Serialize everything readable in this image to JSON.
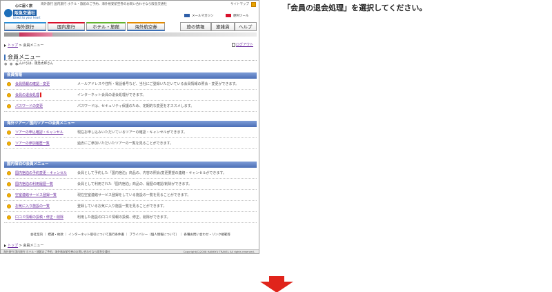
{
  "header": {
    "tagline": "海外旅行 国内旅行 ホテル・旅館のご予約、海外格安航空券のお問い合わせなら阪急交通社",
    "sitemap_label": "サイトマップ",
    "logo_top": "心に届く旅",
    "logo_name": "阪急交通社",
    "logo_sub": "Direct to your heart",
    "mail_magazine": "メールマガジン",
    "convenient_tool": "便利ツール"
  },
  "nav": {
    "tabs": [
      "海外旅行",
      "国内旅行",
      "ホテル・旅館",
      "海外航空券"
    ],
    "right_tabs": [
      "旅の情報",
      "旅雑貨",
      "ヘルプ"
    ]
  },
  "breadcrumb": {
    "top_link": "トップ",
    "current": "会員メニュー"
  },
  "logout_label": "ログアウト",
  "page": {
    "title": "会員メニュー",
    "hello": "こんにちは、阪急太郎さん"
  },
  "sections": [
    {
      "title": "会員情報",
      "items": [
        {
          "link": "会員情報の確認・変更",
          "desc": "メールアドレスや住所・電話番号など、当社にご登録いただいている会員情報の照会・変更ができます。"
        },
        {
          "link": "会員の退会処理",
          "desc": "インターネット会員の退会処理ができます。"
        },
        {
          "link": "パスワードの変更",
          "desc": "パスワードは、セキュリティ保護のため、定期的な変更をオススメします。"
        }
      ]
    },
    {
      "title": "海外ツアー／国内ツアーの会員メニュー",
      "items": [
        {
          "link": "ツアーの申込確認・キャンセル",
          "desc": "現在お申し込みいただいているツアーの確認・キャンセルができます。"
        },
        {
          "link": "ツアーの参加履歴一覧",
          "desc": "過去にご参加いただいたツアーの一覧を見ることができます。"
        }
      ]
    },
    {
      "title": "国内宿泊の会員メニュー",
      "items": [
        {
          "link": "国内宿泊の予約変更・キャンセル",
          "desc": "会員として予約した「国内宿泊」商品の、内容の照会/変更要望の連絡・キャンセルができます。"
        },
        {
          "link": "国内宿泊の利用履歴一覧",
          "desc": "会員として利用された「国内宿泊」商品の、履歴の確認/削除ができます。"
        },
        {
          "link": "空室連絡サービス登録一覧",
          "desc": "現在空室連絡サービス登録をしている施設の一覧を見ることができます。"
        },
        {
          "link": "お気に入り施設の一覧",
          "desc": "登録しているお気に入り施設一覧を見ることができます。"
        },
        {
          "link": "口コミ情報の投稿・修正・削除",
          "desc": "利用した施設の口コミ情報の投稿、修正、削除ができます。"
        }
      ]
    }
  ],
  "footer": {
    "links": "会社案内 ｜ 標識・約款 ｜ インターネット取引について旅行条件書 ｜ プライバシー（個人情報について） ｜ 各種お問い合わせ・リンク規範等",
    "bar_text": "海外旅行 国内旅行 ホテル・旅館のご予約、海外格安航空券のお問い合わせなら阪急交通社",
    "copyright": "Copyright(C)2008 HANKYU TRAVEL All rights reserved."
  },
  "instruction": "「会員の退会処理」を選択してください。",
  "colors": {
    "accent_blue": "#4c6fb6",
    "highlight_red": "#e01a1a",
    "arrow_red": "#e0241b",
    "link_purple": "#6a2a9e"
  }
}
